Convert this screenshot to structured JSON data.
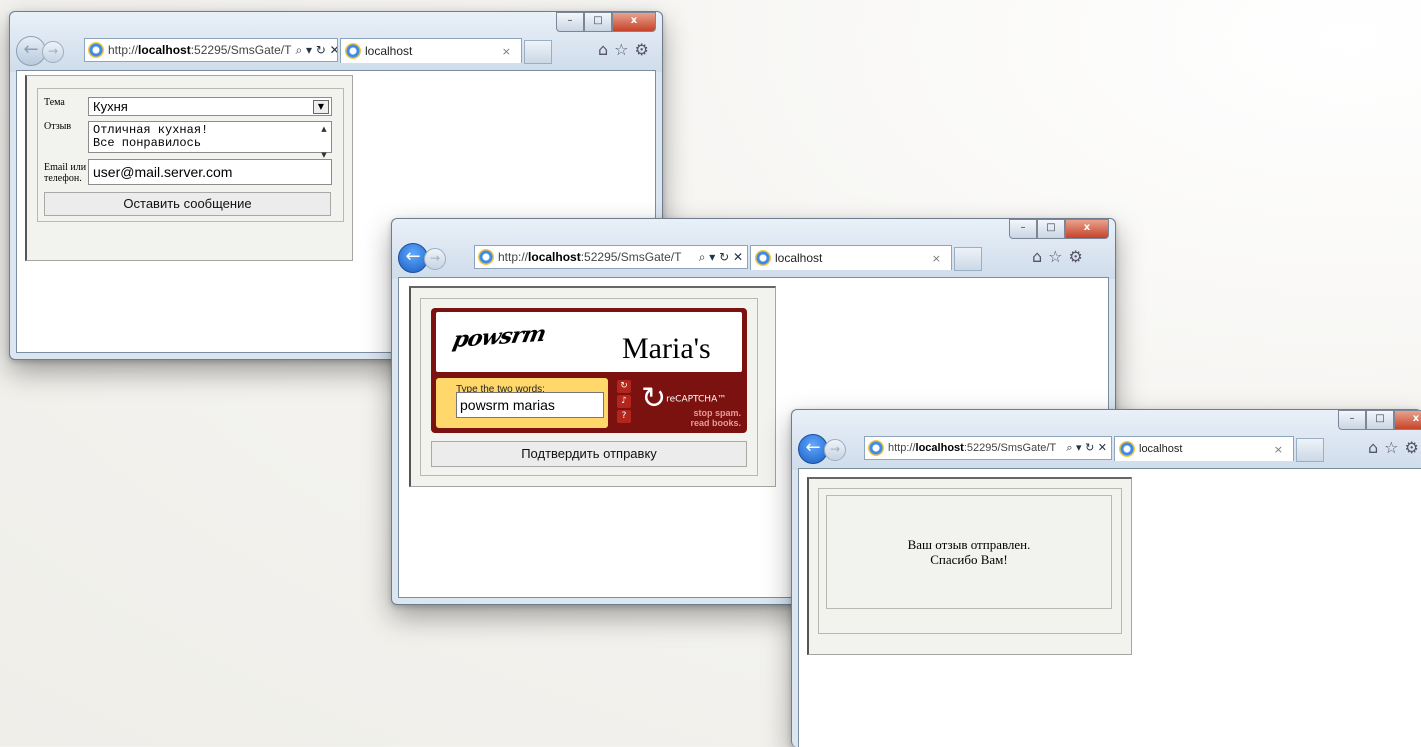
{
  "browser": {
    "address_url_prefix": "http://",
    "address_url_host": "localhost",
    "address_url_rest": ":52295/SmsGate/T",
    "address_controls": "⌕ ▾ ↻ ✕",
    "tab_title": "localhost",
    "tab_close": "×",
    "caption_minimize": "–",
    "caption_maximize": "□",
    "caption_close": "x"
  },
  "window1": {
    "label_topic": "Тема",
    "topic_value": "Кухня",
    "label_review": "Отзыв",
    "review_value_line1": "Отличная кухная!",
    "review_value_line2": "Все понравилось",
    "label_contact_line1": "Email или",
    "label_contact_line2": "телефон.",
    "contact_value": "user@mail.server.com",
    "submit_label": "Оставить сообщение"
  },
  "window2": {
    "captcha_word1": "powsrm",
    "captcha_word2": "Maria's",
    "captcha_prompt": "Type the two words:",
    "captcha_input": "powsrm marias",
    "recaptcha_logo": "reCAPTCHA™",
    "recaptcha_tagline_line1": "stop spam.",
    "recaptcha_tagline_line2": "read books.",
    "confirm_label": "Подтвердить отправку"
  },
  "window3": {
    "message_line1": "Ваш отзыв отправлен.",
    "message_line2": "Спасибо Вам!"
  },
  "colors": {
    "recaptcha_red": "#7b1210",
    "recaptcha_yellow": "#ffd76a",
    "ie_back_active": "#1c5fc2"
  }
}
